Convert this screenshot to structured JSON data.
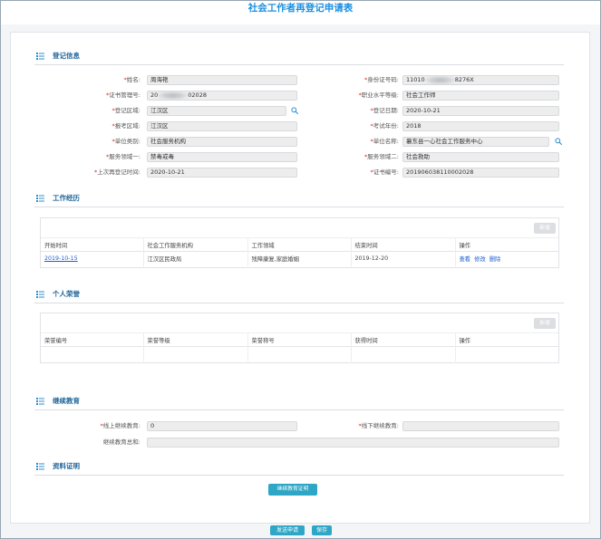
{
  "title": "社会工作者再登记申请表",
  "required_mark": "*",
  "colors": {
    "title": "#1d8fe0",
    "heading": "#22669a",
    "icon": "#2b8fd0",
    "accent": "#2ea6c6",
    "link": "#1f5fd0",
    "required": "#e02424"
  },
  "icons": {
    "section_heading": "list-icon",
    "lookup": "search-icon"
  },
  "registration": {
    "heading": "登记信息",
    "name": {
      "label": "姓名:",
      "value": "周海艳"
    },
    "id_number": {
      "label": "身份证号码:",
      "value_prefix": "11010",
      "value_suffix": "8276X"
    },
    "cert_mgmt_no": {
      "label": "证书管理号:",
      "value_prefix": "20",
      "value_suffix": "02028"
    },
    "level": {
      "label": "职业水平等级:",
      "value": "社会工作师"
    },
    "reg_area": {
      "label": "登记区域:",
      "value": "江汉区"
    },
    "reg_date": {
      "label": "登记日期:",
      "value": "2020-10-21"
    },
    "exam_area": {
      "label": "报考区域:",
      "value": "江汉区"
    },
    "exam_year": {
      "label": "考试年份:",
      "value": "2018"
    },
    "org_type": {
      "label": "单位类别:",
      "value": "社会服务机构"
    },
    "org_name": {
      "label": "单位名称:",
      "value": "襄东县一心社会工作服务中心"
    },
    "service_area_1": {
      "label": "服务领域一:",
      "value": "禁毒戒毒"
    },
    "service_area_2": {
      "label": "服务领域二:",
      "value": "社会救助"
    },
    "last_rereg_time": {
      "label": "上次再登记时间:",
      "value": "2020-10-21"
    },
    "cert_no": {
      "label": "证书编号:",
      "value": "201906038110002028"
    }
  },
  "work_experience": {
    "heading": "工作经历",
    "add_button": "新增",
    "columns": [
      "开始时间",
      "社会工作服务机构",
      "工作领域",
      "结束时间",
      "操作"
    ],
    "rows": [
      {
        "start": "2019-10-15",
        "org": "江汉区民政局",
        "field": "残障康复,家庭婚姻",
        "end": "2019-12-20",
        "actions": [
          "查看",
          "修改",
          "删除"
        ]
      }
    ]
  },
  "honors": {
    "heading": "个人荣誉",
    "add_button": "新增",
    "columns": [
      "荣誉编号",
      "荣誉等级",
      "荣誉称号",
      "获得时间",
      "操作"
    ]
  },
  "continuing_education": {
    "heading": "继续教育",
    "online": {
      "label": "线上继续教育:",
      "value": "0"
    },
    "offline": {
      "label": "线下继续教育:",
      "value": ""
    },
    "total": {
      "label": "继续教育总和:",
      "value": ""
    }
  },
  "materials": {
    "heading": "资料证明",
    "proof_button": "继续教育证明"
  },
  "footer": {
    "submit_button": "发送申请",
    "save_button": "保存"
  }
}
